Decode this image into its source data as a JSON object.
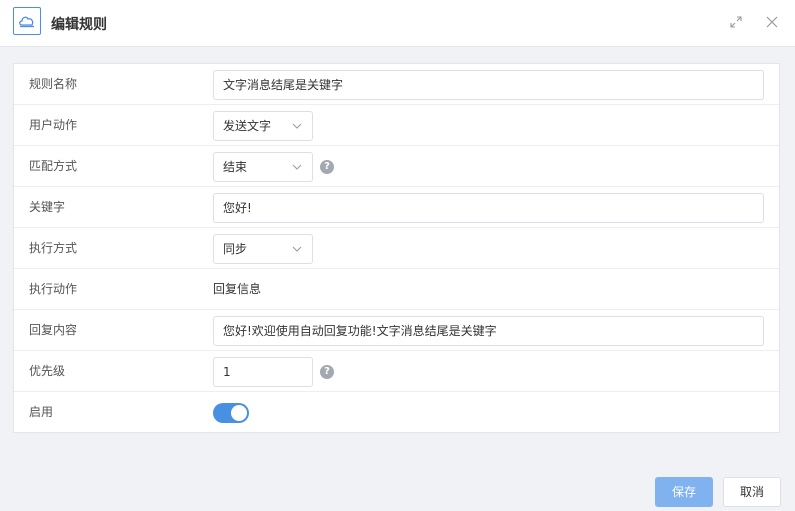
{
  "header": {
    "title": "编辑规则",
    "logo_icon": "cloud-icon",
    "expand_icon": "expand-icon",
    "close_icon": "close-icon"
  },
  "form": {
    "rule_name": {
      "label": "规则名称",
      "value": "文字消息结尾是关键字"
    },
    "user_action": {
      "label": "用户动作",
      "value": "发送文字"
    },
    "match_mode": {
      "label": "匹配方式",
      "value": "结束"
    },
    "keyword": {
      "label": "关键字",
      "value": "您好!"
    },
    "exec_mode": {
      "label": "执行方式",
      "value": "同步"
    },
    "exec_action": {
      "label": "执行动作",
      "value": "回复信息"
    },
    "reply_content": {
      "label": "回复内容",
      "value": "您好!欢迎使用自动回复功能!文字消息结尾是关键字"
    },
    "priority": {
      "label": "优先级",
      "value": "1"
    },
    "enabled": {
      "label": "启用",
      "on": true
    }
  },
  "help_glyph": "?",
  "footer": {
    "save_label": "保存",
    "cancel_label": "取消"
  },
  "colors": {
    "accent": "#4a90e2",
    "save_button": "#7fb2ef"
  }
}
